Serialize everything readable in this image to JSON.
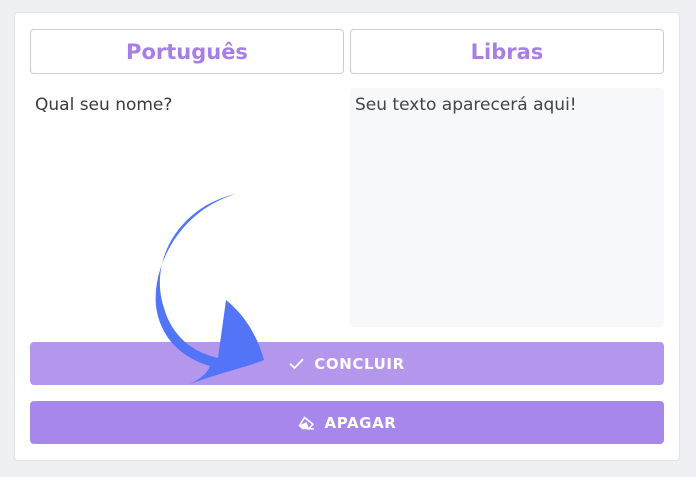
{
  "tabs": {
    "source_label": "Português",
    "target_label": "Libras"
  },
  "input": {
    "value": "Qual seu nome?"
  },
  "output": {
    "placeholder": "Seu texto aparecerá aqui!"
  },
  "buttons": {
    "conclude_label": "CONCLUIR",
    "conclude_icon": "check-icon",
    "clear_label": "APAGAR",
    "clear_icon": "eraser-icon"
  },
  "colors": {
    "accent": "#a67fe6",
    "conclude_bg": "#b596ed",
    "clear_bg": "#a887ec",
    "arrow": "#5274f7"
  }
}
